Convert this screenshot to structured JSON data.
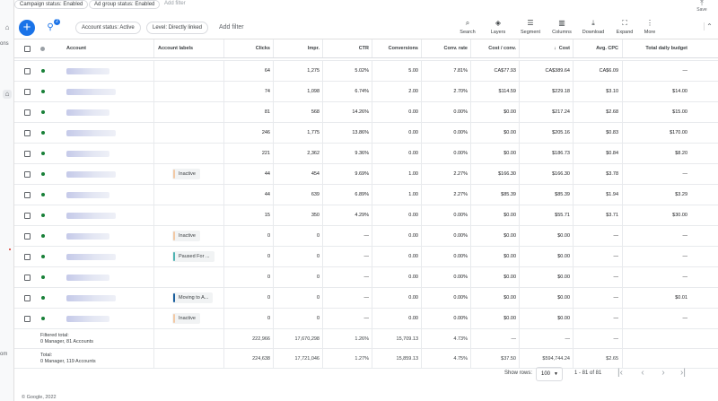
{
  "sidebar": {
    "top_label": "ons",
    "bottom_label": "om"
  },
  "filter_chips": [
    "Campaign status: Enabled",
    "Ad group status: Enabled"
  ],
  "add_filter_top": "Add filter",
  "save_label": "Save",
  "toolbar": {
    "filter_count": "2",
    "chips": [
      "Account status: Active",
      "Level: Directly linked"
    ],
    "add_filter": "Add filter",
    "tools": [
      {
        "icon": "search-icon",
        "glyph": "⌕",
        "label": "Search"
      },
      {
        "icon": "layers-icon",
        "glyph": "◈",
        "label": "Layers"
      },
      {
        "icon": "segment-icon",
        "glyph": "☰",
        "label": "Segment"
      },
      {
        "icon": "columns-icon",
        "glyph": "▥",
        "label": "Columns"
      },
      {
        "icon": "download-icon",
        "glyph": "⤓",
        "label": "Download"
      },
      {
        "icon": "expand-icon",
        "glyph": "⛶",
        "label": "Expand"
      },
      {
        "icon": "more-icon",
        "glyph": "⋮",
        "label": "More"
      }
    ]
  },
  "table": {
    "headers": {
      "account": "Account",
      "labels": "Account labels",
      "clicks": "Clicks",
      "impr": "Impr.",
      "ctr": "CTR",
      "conv": "Conversions",
      "conv_rate": "Conv. rate",
      "cost_conv": "Cost / conv.",
      "cost": "Cost",
      "avg_cpc": "Avg. CPC",
      "budget": "Total daily budget"
    },
    "sort_indicator": "↓",
    "rows": [
      {
        "label": "",
        "clicks": "64",
        "impr": "1,275",
        "ctr": "5.02%",
        "conv": "5.00",
        "conv_rate": "7.81%",
        "cost_conv": "CA$77.93",
        "cost": "CA$389.64",
        "avg_cpc": "CA$6.09",
        "budget": "—"
      },
      {
        "label": "",
        "clicks": "74",
        "impr": "1,098",
        "ctr": "6.74%",
        "conv": "2.00",
        "conv_rate": "2.70%",
        "cost_conv": "$114.59",
        "cost": "$229.18",
        "avg_cpc": "$3.10",
        "budget": "$14.00"
      },
      {
        "label": "",
        "clicks": "81",
        "impr": "568",
        "ctr": "14.26%",
        "conv": "0.00",
        "conv_rate": "0.00%",
        "cost_conv": "$0.00",
        "cost": "$217.24",
        "avg_cpc": "$2.68",
        "budget": "$15.00"
      },
      {
        "label": "",
        "clicks": "246",
        "impr": "1,775",
        "ctr": "13.86%",
        "conv": "0.00",
        "conv_rate": "0.00%",
        "cost_conv": "$0.00",
        "cost": "$205.16",
        "avg_cpc": "$0.83",
        "budget": "$170.00"
      },
      {
        "label": "",
        "clicks": "221",
        "impr": "2,362",
        "ctr": "9.36%",
        "conv": "0.00",
        "conv_rate": "0.00%",
        "cost_conv": "$0.00",
        "cost": "$186.73",
        "avg_cpc": "$0.84",
        "budget": "$8.20"
      },
      {
        "label": "Inactive",
        "label_color": "#f2c9a5",
        "clicks": "44",
        "impr": "454",
        "ctr": "9.69%",
        "conv": "1.00",
        "conv_rate": "2.27%",
        "cost_conv": "$166.30",
        "cost": "$166.30",
        "avg_cpc": "$3.78",
        "budget": "—"
      },
      {
        "label": "",
        "clicks": "44",
        "impr": "639",
        "ctr": "6.89%",
        "conv": "1.00",
        "conv_rate": "2.27%",
        "cost_conv": "$85.39",
        "cost": "$85.39",
        "avg_cpc": "$1.94",
        "budget": "$3.29"
      },
      {
        "label": "",
        "clicks": "15",
        "impr": "350",
        "ctr": "4.29%",
        "conv": "0.00",
        "conv_rate": "0.00%",
        "cost_conv": "$0.00",
        "cost": "$55.71",
        "avg_cpc": "$3.71",
        "budget": "$30.00"
      },
      {
        "label": "Inactive",
        "label_color": "#f2c9a5",
        "clicks": "0",
        "impr": "0",
        "ctr": "—",
        "conv": "0.00",
        "conv_rate": "0.00%",
        "cost_conv": "$0.00",
        "cost": "$0.00",
        "avg_cpc": "—",
        "budget": "—"
      },
      {
        "label": "Paused For ...",
        "label_color": "#4fb3b3",
        "clicks": "0",
        "impr": "0",
        "ctr": "—",
        "conv": "0.00",
        "conv_rate": "0.00%",
        "cost_conv": "$0.00",
        "cost": "$0.00",
        "avg_cpc": "—",
        "budget": "—"
      },
      {
        "label": "",
        "clicks": "0",
        "impr": "0",
        "ctr": "—",
        "conv": "0.00",
        "conv_rate": "0.00%",
        "cost_conv": "$0.00",
        "cost": "$0.00",
        "avg_cpc": "—",
        "budget": "—"
      },
      {
        "label": "Moving to A...",
        "label_color": "#1a5f9e",
        "clicks": "0",
        "impr": "0",
        "ctr": "—",
        "conv": "0.00",
        "conv_rate": "0.00%",
        "cost_conv": "$0.00",
        "cost": "$0.00",
        "avg_cpc": "—",
        "budget": "$0.01"
      },
      {
        "label": "Inactive",
        "label_color": "#f2c9a5",
        "clicks": "0",
        "impr": "0",
        "ctr": "—",
        "conv": "0.00",
        "conv_rate": "0.00%",
        "cost_conv": "$0.00",
        "cost": "$0.00",
        "avg_cpc": "—",
        "budget": "—"
      }
    ],
    "filtered_total": {
      "line1": "Filtered total:",
      "line2": "0 Manager, 81 Accounts",
      "clicks": "222,966",
      "impr": "17,670,298",
      "ctr": "1.26%",
      "conv": "15,709.13",
      "conv_rate": "4.73%",
      "cost_conv": "—",
      "cost": "—",
      "avg_cpc": "—",
      "budget": ""
    },
    "total": {
      "line1": "Total:",
      "line2": "0 Manager, 119 Accounts",
      "clicks": "224,638",
      "impr": "17,721,046",
      "ctr": "1.27%",
      "conv": "15,859.13",
      "conv_rate": "4.75%",
      "cost_conv": "$37.50",
      "cost": "$594,744.24",
      "avg_cpc": "$2.65",
      "budget": ""
    }
  },
  "pager": {
    "show_rows_label": "Show rows:",
    "rows_value": "100",
    "range": "1 - 81 of 81"
  },
  "footer": "© Google, 2022"
}
